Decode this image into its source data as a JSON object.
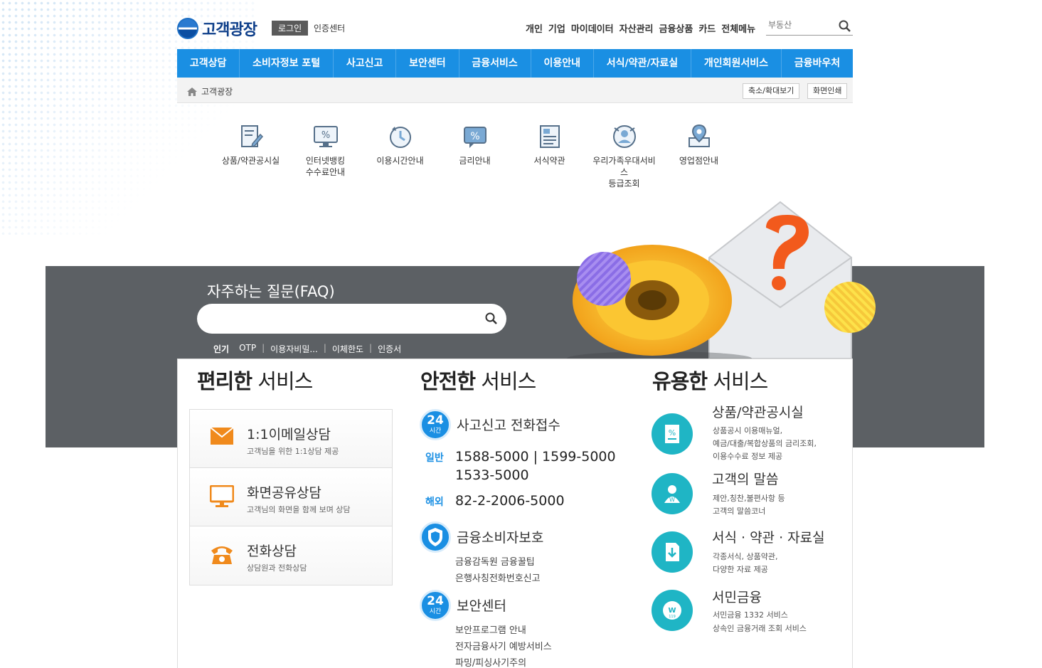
{
  "header": {
    "logo_text": "고객광장",
    "login_label": "로그인",
    "cert_label": "인증센터",
    "top_nav": [
      "개인",
      "기업",
      "마이데이터",
      "자산관리",
      "금융상품",
      "카드",
      "전체메뉴"
    ],
    "search_placeholder": "부동산"
  },
  "gnb": [
    "고객상담",
    "소비자정보 포털",
    "사고신고",
    "보안센터",
    "금융서비스",
    "이용안내",
    "서식/약관/자료실",
    "개인회원서비스",
    "금융바우처"
  ],
  "breadcrumb": {
    "home": "고객광장",
    "zoom_label": "축소/확대보기",
    "print_label": "화면인쇄"
  },
  "quick_links": [
    {
      "line1": "상품/약관공시실",
      "line2": "",
      "line3": ""
    },
    {
      "line1": "인터넷뱅킹",
      "line2": "수수료안내",
      "line3": ""
    },
    {
      "line1": "이용시간안내",
      "line2": "",
      "line3": ""
    },
    {
      "line1": "금리안내",
      "line2": "",
      "line3": ""
    },
    {
      "line1": "서식약관",
      "line2": "",
      "line3": ""
    },
    {
      "line1": "우리가족우대서비",
      "line2": "스",
      "line3": "등급조회"
    },
    {
      "line1": "영업점안내",
      "line2": "",
      "line3": ""
    }
  ],
  "faq": {
    "title": "자주하는 질문(FAQ)",
    "popular_label": "인기",
    "tags": [
      "OTP",
      "이용자비밀...",
      "이체한도",
      "인증서"
    ]
  },
  "convenient": {
    "title_bold": "편리한",
    "title_rest": " 서비스",
    "items": [
      {
        "title": "1:1이메일상담",
        "sub": "고객님을 위한 1:1상담 제공"
      },
      {
        "title": "화면공유상담",
        "sub": "고객님의 화면을 함께 보며 상담"
      },
      {
        "title": "전화상담",
        "sub": "상담원과 전화상담"
      }
    ]
  },
  "safe": {
    "title_bold": "안전한",
    "title_rest": " 서비스",
    "badge_num": "24",
    "badge_text": "시간",
    "accident_title": "사고신고 전화접수",
    "general_label": "일반",
    "general_numbers": "1588-5000 | 1599-5000",
    "general_number2": "1533-5000",
    "overseas_label": "해외",
    "overseas_number": "82-2-2006-5000",
    "protect_title": "금융소비자보호",
    "protect_items": [
      "금융감독원 금융꿀팁",
      "은행사칭전화번호신고"
    ],
    "security_title": "보안센터",
    "security_items": [
      "보안프로그램 안내",
      "전자금융사기 예방서비스",
      "파밍/피싱사기주의"
    ]
  },
  "useful": {
    "title_bold": "유용한",
    "title_rest": " 서비스",
    "items": [
      {
        "title": "상품/약관공시실",
        "d1": "상품공시 이용매뉴얼,",
        "d2": "예금/대출/복합상품의 금리조회,",
        "d3": "이용수수료 정보 제공"
      },
      {
        "title": "고객의 말씀",
        "d1": "제안,칭찬,불편사항 등",
        "d2": "고객의 말씀코너",
        "d3": ""
      },
      {
        "title": "서식 · 약관 · 자료실",
        "d1": "각종서식, 상품약관,",
        "d2": "다양한 자료 제공",
        "d3": ""
      },
      {
        "title": "서민금융",
        "d1": "서민금융 1332 서비스",
        "d2": "상속인 금융거래 조회 서비스",
        "d3": ""
      }
    ]
  },
  "colors": {
    "primary": "#1a8fe3",
    "band": "#5c6064",
    "teal": "#1fb5c5",
    "orange": "#f08a1c"
  }
}
